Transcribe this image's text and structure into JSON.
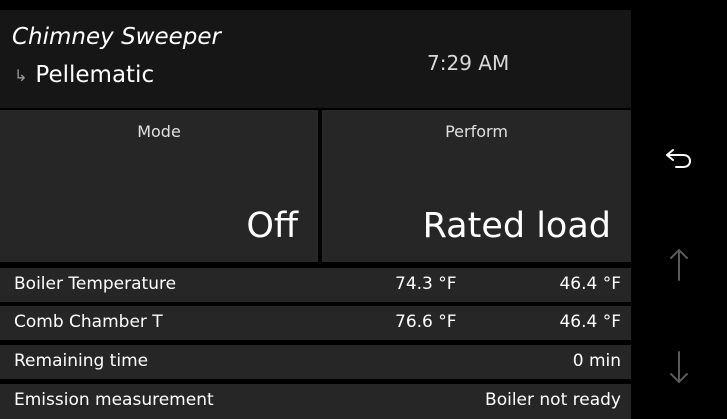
{
  "header": {
    "title": "Chimney Sweeper",
    "subtitle_arrow": "↳",
    "subtitle": "Pellematic",
    "time": "7:29 AM"
  },
  "tiles": {
    "mode": {
      "label": "Mode",
      "value": "Off"
    },
    "perform": {
      "label": "Perform",
      "value": "Rated load"
    }
  },
  "rows": [
    {
      "label": "Boiler Temperature",
      "value1": "74.3 °F",
      "value2": "46.4 °F"
    },
    {
      "label": "Comb Chamber T",
      "value1": "76.6 °F",
      "value2": "46.4 °F"
    },
    {
      "label": "Remaining time",
      "value1": "",
      "value2": "0 min"
    },
    {
      "label": "Emission measurement",
      "value1": "",
      "value2": "Boiler not ready"
    }
  ],
  "side_buttons": {
    "back_icon": "back-arrow-icon",
    "up_icon": "arrow-up-icon",
    "down_icon": "arrow-down-icon"
  },
  "colors": {
    "background": "#000000",
    "header": "#161616",
    "tile": "#262626",
    "active_icon": "#ffffff",
    "inactive_icon": "#5a5a5a"
  }
}
